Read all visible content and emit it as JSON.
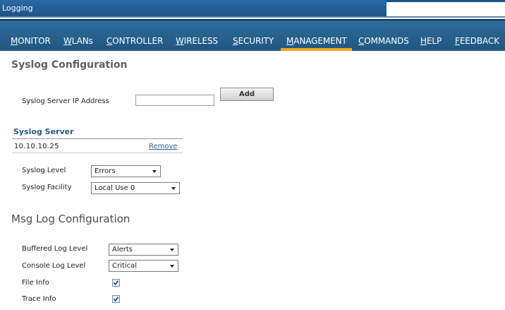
{
  "window": {
    "title": "Logging"
  },
  "nav": {
    "items": [
      {
        "label": "MONITOR"
      },
      {
        "label": "WLANs"
      },
      {
        "label": "CONTROLLER"
      },
      {
        "label": "WIRELESS"
      },
      {
        "label": "SECURITY"
      },
      {
        "label": "MANAGEMENT",
        "active": true
      },
      {
        "label": "COMMANDS"
      },
      {
        "label": "HELP"
      },
      {
        "label": "FEEDBACK"
      }
    ],
    "active_color": "#f0a11a"
  },
  "syslog_config": {
    "title": "Syslog Configuration",
    "server_ip_label": "Syslog Server IP Address",
    "server_ip_value": "",
    "add_label": "Add",
    "server_section_title": "Syslog Server",
    "servers": [
      {
        "ip": "10.10.10.25",
        "remove_label": "Remove"
      }
    ],
    "level_label": "Syslog Level",
    "level_value": "Errors",
    "facility_label": "Syslog Facility",
    "facility_value": "Local Use 0"
  },
  "msg_log_config": {
    "title": "Msg Log Configuration",
    "buffered_label": "Buffered Log Level",
    "buffered_value": "Alerts",
    "console_label": "Console Log Level",
    "console_value": "Critical",
    "file_info_label": "File Info",
    "file_info_checked": true,
    "trace_info_label": "Trace Info",
    "trace_info_checked": true
  }
}
